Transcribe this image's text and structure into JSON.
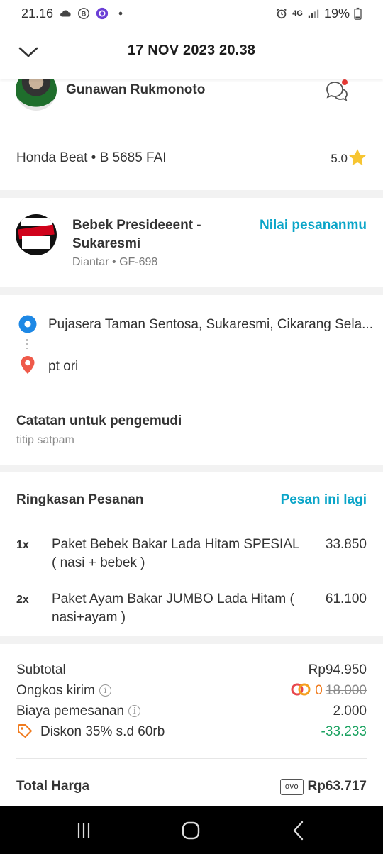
{
  "status_bar": {
    "time": "21.16",
    "network": "4G",
    "battery": "19%"
  },
  "header": {
    "title": "17 NOV 2023 20.38"
  },
  "driver": {
    "name": "Gunawan Rukmonoto",
    "vehicle": "Honda Beat • B 5685 FAI",
    "rating": "5.0"
  },
  "restaurant": {
    "name": "Bebek Presideeent - Sukaresmi",
    "subtitle": "Diantar • GF-698",
    "rate_link": "Nilai pesananmu"
  },
  "route": {
    "pickup": "Pujasera Taman Sentosa, Sukaresmi, Cikarang Sela...",
    "dropoff": "pt ori"
  },
  "notes": {
    "title": "Catatan untuk pengemudi",
    "text": "titip satpam"
  },
  "summary": {
    "title": "Ringkasan Pesanan",
    "reorder": "Pesan ini lagi",
    "items": [
      {
        "qty": "1x",
        "name": "Paket Bebek Bakar Lada Hitam SPESIAL ( nasi + bebek )",
        "price": "33.850"
      },
      {
        "qty": "2x",
        "name": "Paket Ayam Bakar JUMBO Lada Hitam ( nasi+ayam )",
        "price": "61.100"
      }
    ]
  },
  "payment": {
    "subtotal_label": "Subtotal",
    "subtotal_value": "Rp94.950",
    "delivery_label": "Ongkos kirim",
    "delivery_value": "0",
    "delivery_original": "18.000",
    "order_fee_label": "Biaya pemesanan",
    "order_fee_value": "2.000",
    "discount_label": "Diskon 35% s.d 60rb",
    "discount_value": "-33.233",
    "total_label": "Total Harga",
    "payment_method": "ovo",
    "total_value": "Rp63.717"
  },
  "colors": {
    "accent": "#0aa5c8",
    "discount": "#1aa260",
    "pickup": "#1e88e5",
    "dropoff": "#ef5a4a",
    "star": "#f7c531"
  }
}
